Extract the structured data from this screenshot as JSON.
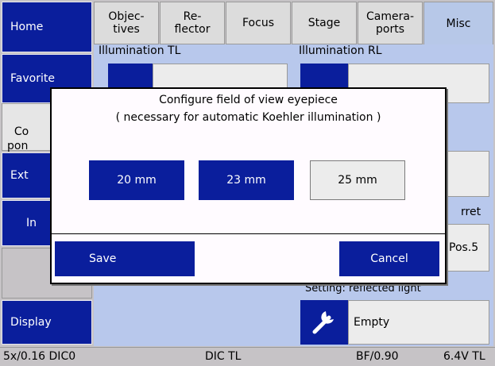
{
  "sidebar": {
    "home": "Home",
    "favorite": "Favorite",
    "components": "Co\npon",
    "ext": "Ext",
    "in": "In",
    "display": "Display"
  },
  "tabs": [
    {
      "label": "Objec-\ntives"
    },
    {
      "label": "Re-\nflector"
    },
    {
      "label": "Focus"
    },
    {
      "label": "Stage"
    },
    {
      "label": "Camera-\nports"
    },
    {
      "label": "Misc"
    }
  ],
  "panel": {
    "illumination_tl": "Illumination TL",
    "illumination_rl": "Illumination RL",
    "turret_fragment": "rret",
    "pos_fragment": "Pos.5",
    "setting_reflected_light": "Setting: reflected light",
    "empty_label": "Empty"
  },
  "dialog": {
    "title_line1": "Configure field of view eyepiece",
    "title_line2": "( necessary for automatic Koehler illumination )",
    "options": [
      "20 mm",
      "23 mm",
      "25 mm"
    ],
    "selected_option": "25 mm",
    "save": "Save",
    "cancel": "Cancel"
  },
  "status": {
    "objective": "5x/0.16 DIC0",
    "contrast": "DIC TL",
    "aperture": "BF/0.90",
    "voltage": "6.4V TL"
  },
  "colors": {
    "accent_blue": "#0a1e9c",
    "panel_blue": "#b8c8ec",
    "dialog_bg": "#fffbff"
  }
}
